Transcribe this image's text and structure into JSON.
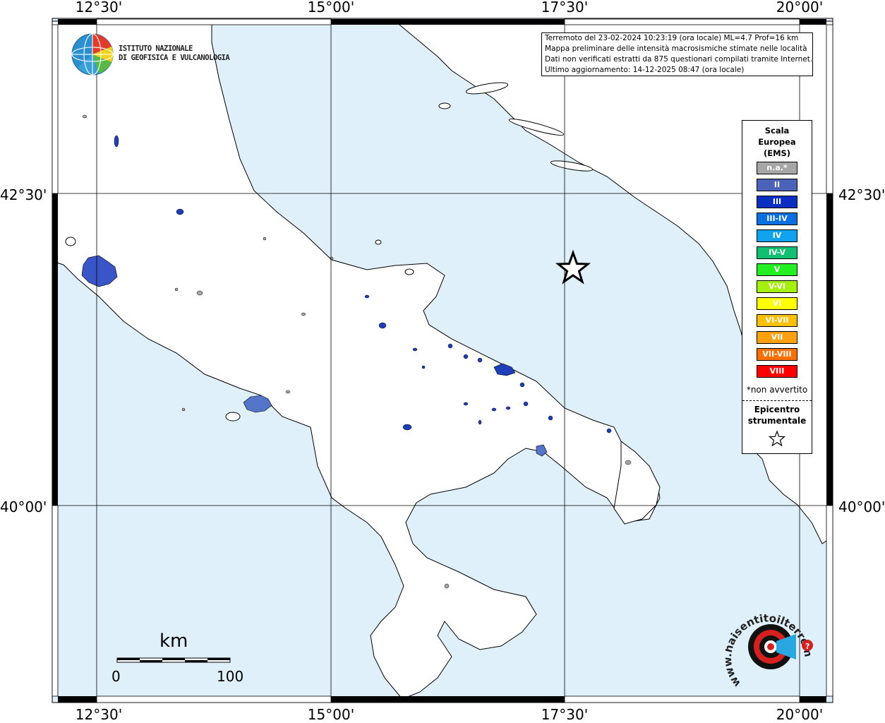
{
  "map": {
    "colors": {
      "sea": "#dff0fb",
      "land": "#ffffff",
      "coast": "#000000",
      "frame": "#000000"
    },
    "longitude_labels": [
      "12°30'",
      "15°00'",
      "17°30'",
      "20°00'"
    ],
    "latitude_labels": [
      "42°30'",
      "40°00'"
    ]
  },
  "info": {
    "line1": "Terremoto del 23-02-2024 10:23:19 (ora locale) ML=4.7 Prof=16 km",
    "line2": "Mappa preliminare delle intensità macrosismiche stimate nelle località",
    "line3": "Dati non verificati estratti da 875 questionari compilati tramite Internet.",
    "line4": "Ultimo aggiornamento: 14-12-2025 08:47 (ora locale)"
  },
  "legend": {
    "title1": "Scala",
    "title2": "Europea",
    "title3": "(EMS)",
    "items": [
      {
        "label": "n.a.*",
        "color": "#a6a6a6"
      },
      {
        "label": "II",
        "color": "#4a63b8"
      },
      {
        "label": "III",
        "color": "#0b2fc0"
      },
      {
        "label": "III-IV",
        "color": "#0a6fe0"
      },
      {
        "label": "IV",
        "color": "#12a3f0"
      },
      {
        "label": "IV-V",
        "color": "#10c070"
      },
      {
        "label": "V",
        "color": "#22f022"
      },
      {
        "label": "V-VI",
        "color": "#a6f010"
      },
      {
        "label": "VI",
        "color": "#ffff00"
      },
      {
        "label": "VI-VII",
        "color": "#ffc000"
      },
      {
        "label": "VII",
        "color": "#ffa010"
      },
      {
        "label": "VII-VIII",
        "color": "#ff7000"
      },
      {
        "label": "VIII",
        "color": "#ff0000"
      }
    ],
    "note": "*non avvertito",
    "epicenter_label1": "Epicentro",
    "epicenter_label2": "strumentale"
  },
  "logo": {
    "line1": "ISTITUTO NAZIONALE",
    "line2": "DI GEOFISICA E VULCANOLOGIA"
  },
  "scalebar": {
    "unit": "km",
    "start": "0",
    "end": "100"
  },
  "hsit": {
    "text": "www.haisentitoilterremoto.it"
  }
}
